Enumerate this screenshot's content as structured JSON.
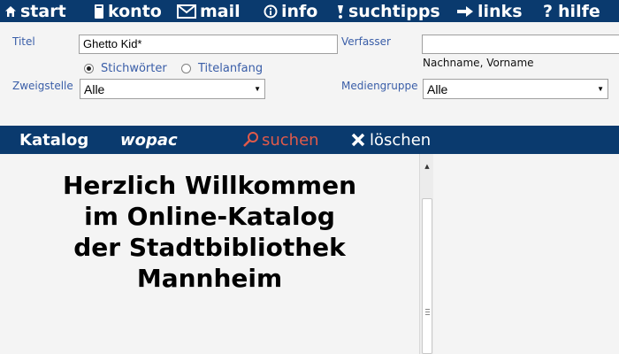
{
  "topnav": {
    "items": [
      {
        "label": "start",
        "icon": "home-icon"
      },
      {
        "label": "konto",
        "icon": "card-icon"
      },
      {
        "label": "mail",
        "icon": "envelope-icon"
      },
      {
        "label": "info",
        "icon": "info-icon"
      },
      {
        "label": "suchtipps",
        "icon": "exclamation-icon"
      },
      {
        "label": "links",
        "icon": "arrow-right-icon"
      },
      {
        "label": "hilfe",
        "icon": "question-icon"
      }
    ]
  },
  "form": {
    "titel_label": "Titel",
    "titel_value": "Ghetto Kid*",
    "verfasser_label": "Verfasser",
    "verfasser_value": "",
    "verfasser_hint": "Nachname, Vorname",
    "radio_stichwoerter": "Stichwörter",
    "radio_titelanfang": "Titelanfang",
    "zweigstelle_label": "Zweigstelle",
    "zweigstelle_value": "Alle",
    "mediengruppe_label": "Mediengruppe",
    "mediengruppe_value": "Alle"
  },
  "bar2": {
    "katalog": "Katalog",
    "wopac": "wopac",
    "suchen": "suchen",
    "loeschen": "löschen"
  },
  "main": {
    "welcome_line1": "Herzlich Willkommen",
    "welcome_line2": "im Online-Katalog",
    "welcome_line3": "der Stadtbibliothek",
    "welcome_line4": "Mannheim"
  },
  "colors": {
    "nav_bg": "#0a3a6e",
    "label_blue": "#3a5ea8",
    "suchen_red": "#e05a4a"
  }
}
